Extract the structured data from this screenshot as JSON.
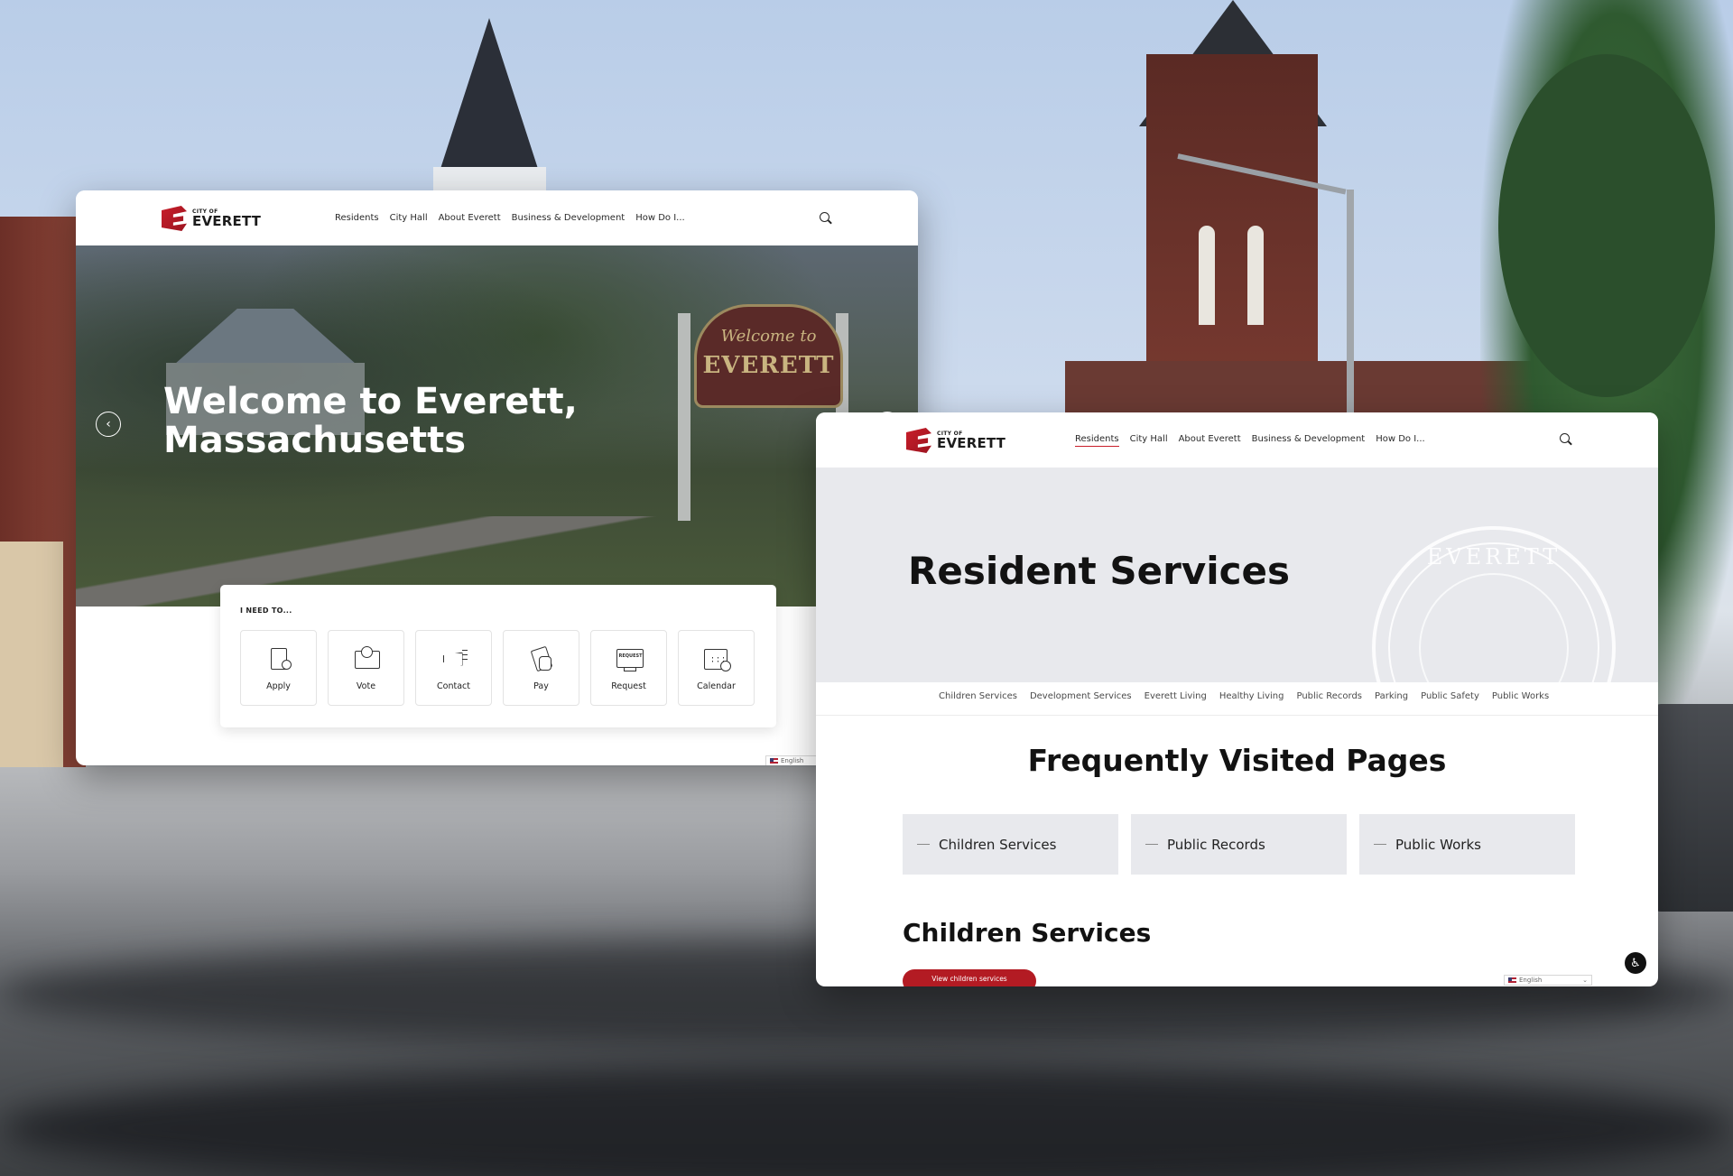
{
  "logo": {
    "small": "CITY OF",
    "big": "EVERETT"
  },
  "nav": [
    "Residents",
    "City Hall",
    "About Everett",
    "Business & Development",
    "How Do I..."
  ],
  "home": {
    "hero_title": "Welcome to Everett, Massachusetts",
    "sign_line1": "Welcome to",
    "sign_line2": "EVERETT",
    "prev_symbol": "‹",
    "next_symbol": "›",
    "need_label": "I NEED TO...",
    "actions": [
      {
        "label": "Apply",
        "icon": "apply-clipboard-icon"
      },
      {
        "label": "Vote",
        "icon": "vote-ballot-icon"
      },
      {
        "label": "Contact",
        "icon": "megaphone-icon"
      },
      {
        "label": "Pay",
        "icon": "pay-hand-icon"
      },
      {
        "label": "Request",
        "icon": "request-monitor-icon",
        "icon_text": "REQUEST"
      },
      {
        "label": "Calendar",
        "icon": "calendar-icon"
      }
    ],
    "language": "English"
  },
  "residents": {
    "active_nav": "Residents",
    "hero_title": "Resident Services",
    "seal_text": "EVERETT",
    "subnav": [
      "Children Services",
      "Development Services",
      "Everett Living",
      "Healthy Living",
      "Public Records",
      "Parking",
      "Public Safety",
      "Public Works"
    ],
    "frequently_title": "Frequently Visited Pages",
    "frequent_pages": [
      "Children Services",
      "Public Records",
      "Public Works"
    ],
    "section_title": "Children Services",
    "section_button": "View children services",
    "language": "English"
  },
  "colors": {
    "brand_red": "#c81e2a",
    "button_red": "#b31b23",
    "hero_gray": "#e8e9ed"
  }
}
